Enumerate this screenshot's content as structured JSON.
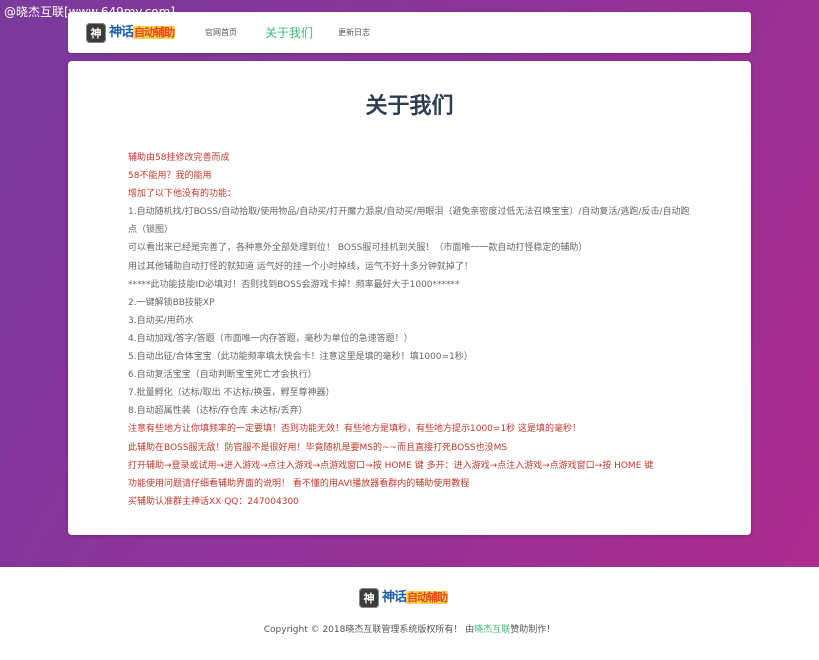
{
  "watermark": "@晓杰互联[www.649my.com]",
  "logo": {
    "badge": "神",
    "text_main": "神话",
    "text_accent": "自动辅助"
  },
  "nav": {
    "items": [
      {
        "label": "官网首页"
      },
      {
        "label": "关于我们"
      },
      {
        "label": "更新日志"
      }
    ]
  },
  "main": {
    "title": "关于我们",
    "lines": [
      {
        "text": " 辅助由58挂修改完善而成"
      },
      {
        "text": "58不能用？我的能用"
      },
      {
        "text": "增加了以下他没有的功能："
      },
      {
        "text": "1.自动随机找/打BOSS/自动拾取/使用物品/自动买/打开魔力源泉/自动买/用眼泪（避免亲密度过低无法召唤宝宝）/自动复活/逃跑/反击/自动跑点（锁图）"
      },
      {
        "text": "可以看出来已经是完善了，各种意外全部处理到位！ BOSS服可挂机到关服！（市面唯一一款自动打怪稳定的辅助）"
      },
      {
        "text": "用过其他辅助自动打怪的就知道 运气好的挂一个小时掉线，运气不好十多分钟就掉了！"
      },
      {
        "text": "*****此功能技能ID必填对！否则找到BOSS会游戏卡掉！频率最好大于1000******"
      },
      {
        "text": "2.一键解锁BB技能XP"
      },
      {
        "text": "3.自动买/用药水"
      },
      {
        "text": "4.自动加戏/答字/答题（市面唯一内存答题，毫秒为单位的急速答题！）"
      },
      {
        "text": "5.自动出征/合体宝宝（此功能频率填太快会卡！注意这里是填的毫秒！填1000=1秒）"
      },
      {
        "text": "6.自动复活宝宝（自动判断宝宝死亡才会执行）"
      },
      {
        "text": "7.批量孵化（达标/取出 不达标/换蛋，孵至尊神器）"
      },
      {
        "text": "8.自动超属性装（达标/存仓库 未达标/丢弃）"
      },
      {
        "text": "注意有些地方让你填频率的一定要填！否则功能无效！有些地方是填秒，有些地方提示1000=1秒 这是填的毫秒！"
      },
      {
        "text": "此辅助在BOSS服无敌！防官服不是很好用！毕竟随机是要MS的~~而且直接打死BOSS也没MS"
      },
      {
        "text": "打开辅助→登录或试用→进入游戏→点注入游戏→点游戏窗口→按 HOME 键   多开：进入游戏→点注入游戏→点游戏窗口→按 HOME 键"
      },
      {
        "text": "功能使用问题请仔细看辅助界面的说明！ 看不懂的用AVI播放器看群内的辅助使用教程"
      },
      {
        "text": "买辅助认准群主神话XX QQ：247004300"
      }
    ]
  },
  "footer": {
    "copyright_prefix": "Copyright © 2018晓杰互联管理系统版权所有！ 由",
    "copyright_link": "晓杰互联",
    "copyright_suffix": "赞助制作！"
  }
}
